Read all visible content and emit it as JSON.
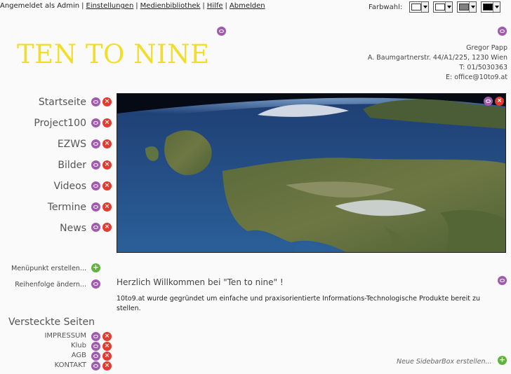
{
  "admin_bar": {
    "logged_in": "Angemeldet als Admin",
    "links": [
      "Einstellungen",
      "Medienbibliothek",
      "Hilfe",
      "Abmelden"
    ]
  },
  "color_picker": {
    "label": "Farbwahl:",
    "swatches": [
      "#ffffff",
      "#ffffff",
      "#808080",
      "#000000"
    ]
  },
  "header": {
    "logo": "TEN TO NINE",
    "logo_color": "#f2de29",
    "contact": [
      "Gregor Papp",
      "A. Baumgartnerstr. 44/A1/225, 1230 Wien",
      "T: 01/5030363",
      "E: office@10to9.at"
    ]
  },
  "nav": {
    "items": [
      "Startseite",
      "Project100",
      "EZWS",
      "Bilder",
      "Videos",
      "Termine",
      "News"
    ]
  },
  "sidebar": {
    "create_menu_item": "Menüpunkt erstellen...",
    "reorder": "Reihenfolge ändern...",
    "hidden_pages_title": "Versteckte Seiten",
    "hidden_pages": [
      "IMPRESSUM",
      "Klub",
      "AGB",
      "KONTAKT"
    ]
  },
  "content": {
    "welcome_heading": "Herzlich Willkommen bei \"Ten to nine\" !",
    "welcome_text": "10to9.at wurde gegründet um einfache und praxisorientierte Informations-Technologische Produkte bereit zu stellen.",
    "new_sidebar_box": "Neue SidebarBox erstellen..."
  },
  "icons": {
    "edit": "edit-icon",
    "delete": "delete-icon",
    "add": "add-icon"
  },
  "colors": {
    "edit": "#a25ab0",
    "delete": "#e23b2f",
    "add": "#5fb33a"
  }
}
